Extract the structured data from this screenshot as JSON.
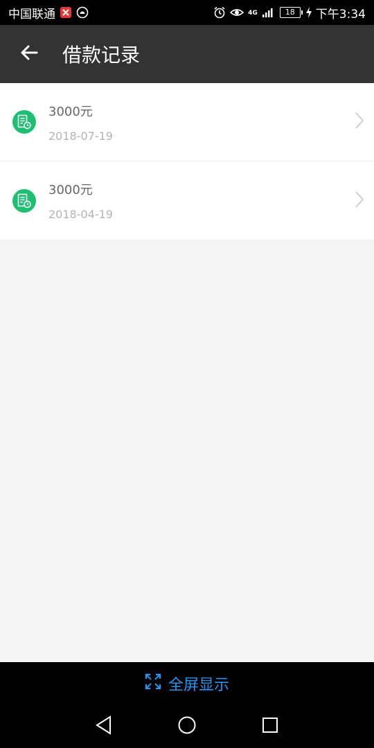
{
  "status_bar": {
    "carrier": "中国联通",
    "network": "4G",
    "battery": "18",
    "time": "下午3:34",
    "icons": [
      "app-notification-icon",
      "android-icon",
      "alarm-icon",
      "eye-icon",
      "signal-icon",
      "battery-icon",
      "charging-icon"
    ]
  },
  "header": {
    "title": "借款记录",
    "back_icon": "arrow-left-icon",
    "background": "#333333"
  },
  "records": [
    {
      "amount": "3000元",
      "date": "2018-07-19"
    },
    {
      "amount": "3000元",
      "date": "2018-04-19"
    }
  ],
  "colors": {
    "accent_green": "#1fbf73",
    "link_blue": "#2196f3"
  },
  "bottom": {
    "fullscreen_label": "全屏显示",
    "fullscreen_icon": "expand-icon",
    "nav": [
      "back-triangle-icon",
      "home-circle-icon",
      "recents-square-icon"
    ]
  }
}
